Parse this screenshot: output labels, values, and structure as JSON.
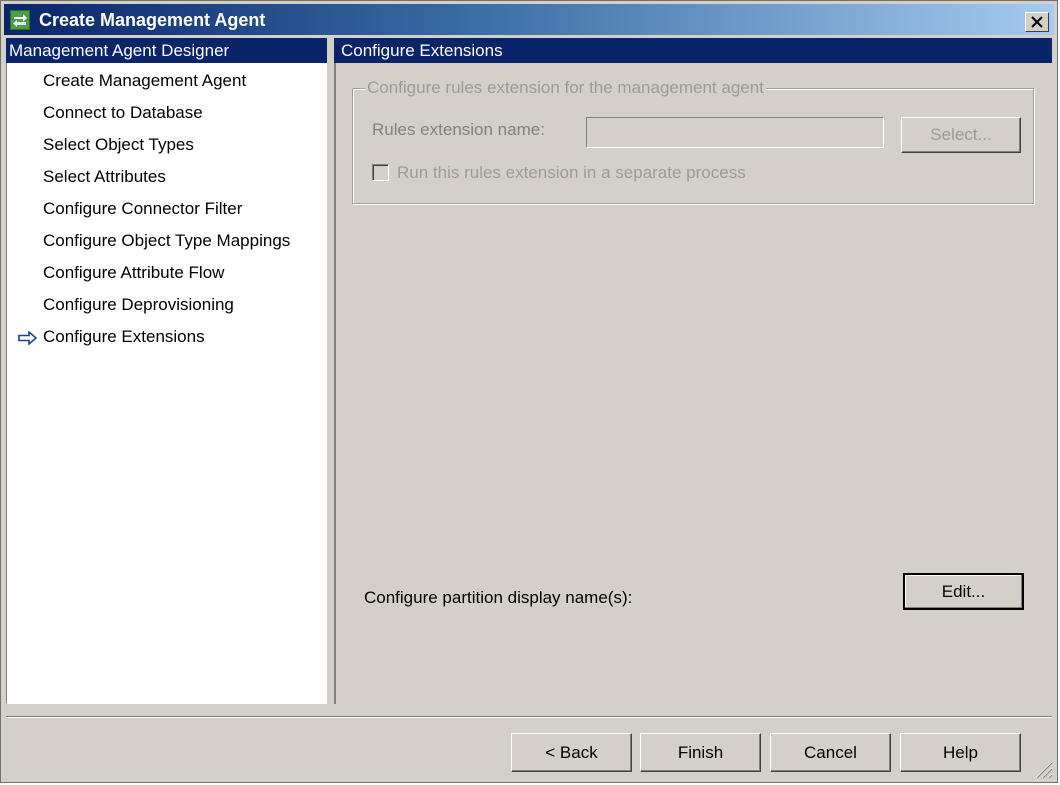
{
  "window": {
    "title": "Create Management Agent"
  },
  "sidebar": {
    "header": "Management Agent Designer",
    "items": [
      {
        "label": "Create Management Agent"
      },
      {
        "label": "Connect to Database"
      },
      {
        "label": "Select Object Types"
      },
      {
        "label": "Select Attributes"
      },
      {
        "label": "Configure Connector Filter"
      },
      {
        "label": "Configure Object Type Mappings"
      },
      {
        "label": "Configure Attribute Flow"
      },
      {
        "label": "Configure Deprovisioning"
      },
      {
        "label": "Configure Extensions"
      }
    ],
    "current_index": 8
  },
  "main": {
    "header": "Configure Extensions",
    "group_title": "Configure rules extension for the management agent",
    "rules_label": "Rules extension name:",
    "rules_value": "",
    "select_label": "Select...",
    "separate_process_label": "Run this rules extension in a separate process",
    "separate_process_checked": false,
    "partition_label": "Configure partition display name(s):",
    "edit_label": "Edit..."
  },
  "footer": {
    "back_label": "< Back",
    "finish_label": "Finish",
    "cancel_label": "Cancel",
    "help_label": "Help"
  },
  "icons": {
    "app": "management-agent-icon",
    "close": "close-icon",
    "current_step": "arrow-right-icon",
    "resize": "resize-grip-icon"
  }
}
